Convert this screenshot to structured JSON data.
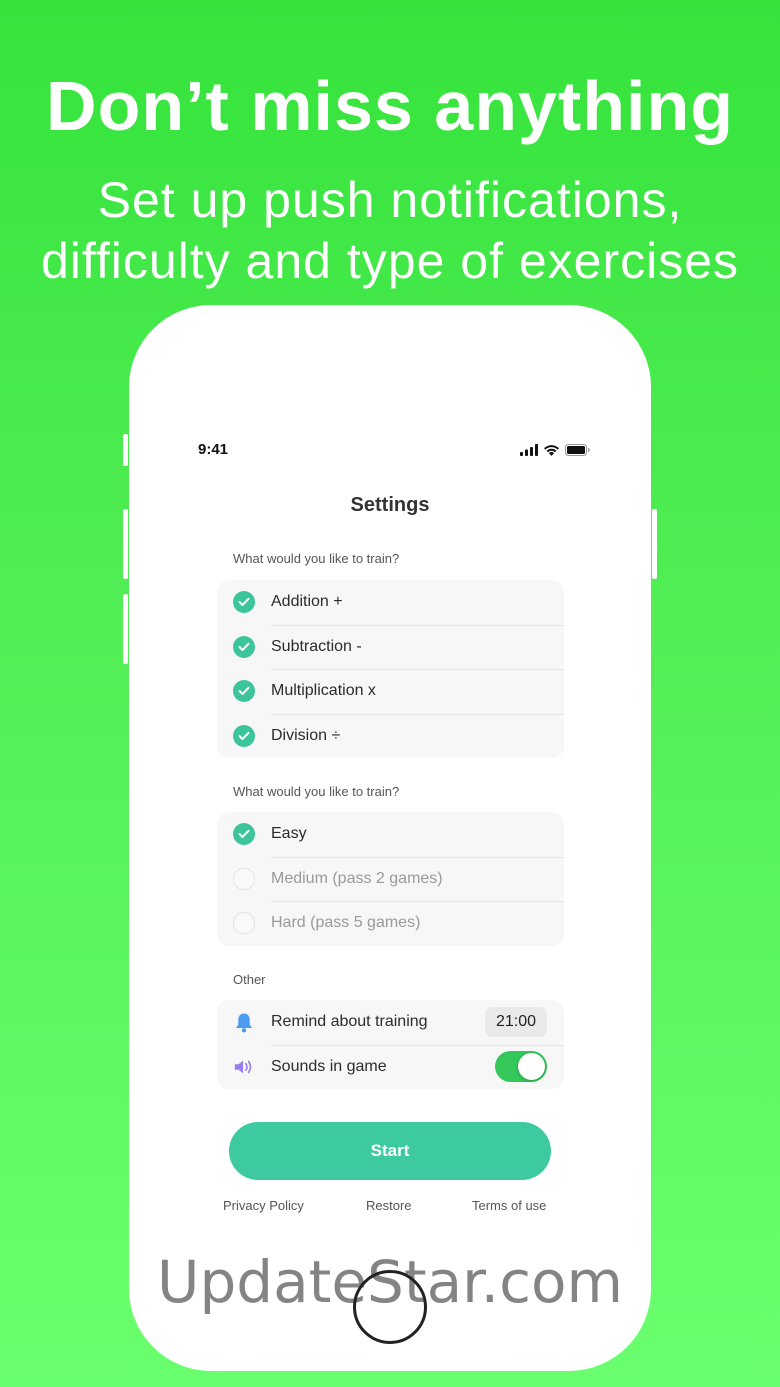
{
  "headline": "Don’t miss anything",
  "subhead_line1": "Set up push notifications,",
  "subhead_line2": "difficulty and type of exercises",
  "status_bar": {
    "time": "9:41"
  },
  "screen_title": "Settings",
  "exercises": {
    "label": "What would you like to train?",
    "items": [
      {
        "label": "Addition +",
        "checked": true
      },
      {
        "label": "Subtraction -",
        "checked": true
      },
      {
        "label": "Multiplication x",
        "checked": true
      },
      {
        "label": "Division ÷",
        "checked": true
      }
    ]
  },
  "difficulty": {
    "label": "What would you like to train?",
    "items": [
      {
        "label": "Easy",
        "selected": true
      },
      {
        "label": "Medium (pass 2 games)",
        "selected": false
      },
      {
        "label": "Hard (pass 5 games)",
        "selected": false
      }
    ]
  },
  "other": {
    "label": "Other",
    "remind": {
      "label": "Remind about training",
      "time": "21:00",
      "icon": "bell-icon"
    },
    "sounds": {
      "label": "Sounds in game",
      "enabled": true,
      "icon": "speaker-icon"
    }
  },
  "start_button": "Start",
  "footer": {
    "privacy": "Privacy Policy",
    "restore": "Restore",
    "terms": "Terms of use"
  },
  "watermark": "UpdateStar.com",
  "colors": {
    "background": "#35e33b",
    "accent": "#3ecaa0",
    "toggle_on": "#34c759"
  }
}
